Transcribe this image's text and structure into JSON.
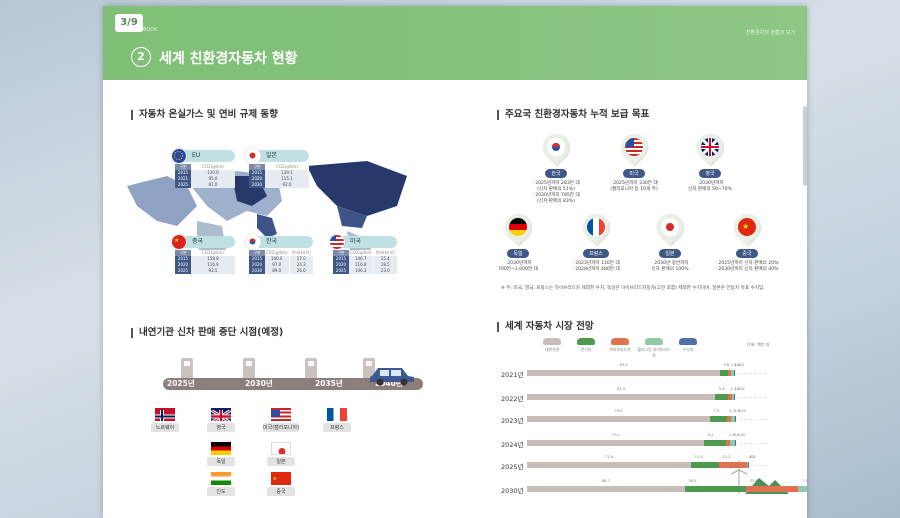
{
  "header": {
    "page_indicator": "3/9",
    "book_label": "BOOK",
    "right_label": "친환경차의 현황과 보기",
    "section_number": "2",
    "section_title": "세계 친환경자동차 현황"
  },
  "emissions": {
    "title": "자동차 온실가스 및 연비 규제 동향",
    "regions": [
      {
        "name": "EU",
        "col1": "구분",
        "col2": "CO2(g/km)",
        "rows": [
          [
            "2015",
            "130.0"
          ],
          [
            "2021",
            "95.0"
          ],
          [
            "2025",
            "81.0"
          ]
        ]
      },
      {
        "name": "일본",
        "col1": "구분",
        "col2": "CO2(g/km)",
        "rows": [
          [
            "2015",
            "139.1"
          ],
          [
            "2020",
            "115.1"
          ],
          [
            "2030",
            "92.0"
          ]
        ]
      },
      {
        "name": "중국",
        "col1": "구분",
        "col2": "CO2(g/km)",
        "rows": [
          [
            "2015",
            "158.8"
          ],
          [
            "2020",
            "116.9"
          ],
          [
            "2025",
            "93.5"
          ]
        ]
      },
      {
        "name": "한국",
        "col1": "구분",
        "col2": "CO2(g/km)",
        "col3": "연비(km/l)",
        "rows": [
          [
            "2015",
            "140.0",
            "17.0"
          ],
          [
            "2020",
            "97.0",
            "24.3"
          ],
          [
            "2030",
            "89.0",
            "26.0"
          ]
        ]
      },
      {
        "name": "미국",
        "col1": "구분",
        "col2": "CO2(g/km)",
        "col3": "연비(km/l)",
        "rows": [
          [
            "2015",
            "146.7",
            "15.4"
          ],
          [
            "2020",
            "116.8",
            "18.5"
          ],
          [
            "2025",
            "106.3",
            "23.0"
          ]
        ]
      }
    ]
  },
  "phaseout": {
    "title": "내연기관 신차 판매 중단 시점(예정)",
    "years": [
      "2025년",
      "2030년",
      "2035년",
      "2040년"
    ],
    "countries": {
      "y2025": [
        "노르웨이"
      ],
      "y2030": [
        "영국",
        "독일",
        "인도"
      ],
      "y2035": [
        "미국(캘리포니아)",
        "일본",
        "중국"
      ],
      "y2040": [
        "프랑스"
      ]
    }
  },
  "targets": {
    "title": "주요국 친환경자동차 누적 보급 목표",
    "items": [
      {
        "name": "한국",
        "desc": [
          "· 2025년까지 283만 대",
          "(신차 판매의 51%)",
          "· 2030년까지 785만 대",
          "(신차 판매의 83%)"
        ]
      },
      {
        "name": "미국",
        "desc": [
          "· 2025년까지 330만 대",
          "(캘리포니아 등 10개 주)"
        ]
      },
      {
        "name": "영국",
        "desc": [
          "· 2030년까지",
          "신차 판매의 50~70%"
        ]
      },
      {
        "name": "독일",
        "desc": [
          "· 2030년까지",
          "700만~1,000만 대"
        ]
      },
      {
        "name": "프랑스",
        "desc": [
          "· 2023년까지 116만 대",
          "· 2028년까지 480만 대"
        ]
      },
      {
        "name": "일본",
        "desc": [
          "· 2030년 중반까지",
          "신차 판매의 100%"
        ]
      },
      {
        "name": "중국",
        "desc": [
          "· 2025년까지 신차 판매의 20%",
          "· 2030년까지 신차 판매의 40%"
        ]
      }
    ],
    "note": "※ 주: 미국, 영국, 프랑스는 하이브리드차 제외한 수치, 독일은 하이브리드자동차(고전 포함) 제외한 수치이며, 일본은 전동차 목표 수치임."
  },
  "market": {
    "title": "세계 자동차 시장 전망",
    "unit": "단위: 백만 대",
    "legend": [
      {
        "label": "내연기관",
        "color": "#c8bdb8"
      },
      {
        "label": "전기차",
        "color": "#4c9a4e"
      },
      {
        "label": "하이브리드차",
        "color": "#e0734f"
      },
      {
        "label": "플러그인 하이브리드차",
        "color": "#8cc9a6"
      },
      {
        "label": "수소차",
        "color": "#4f6fa8"
      }
    ]
  },
  "chart_data": {
    "type": "bar",
    "stacked": true,
    "orientation": "horizontal",
    "title": "세계 자동차 시장 전망",
    "unit": "단위: 백만 대",
    "categories": [
      "2021년",
      "2022년",
      "2023년",
      "2024년",
      "2025년",
      "2030년"
    ],
    "series": [
      {
        "name": "내연기관",
        "color": "#c8bdb8",
        "values": [
          83.9,
          81.9,
          79.5,
          77.0,
          71.4,
          68.7
        ]
      },
      {
        "name": "전기차",
        "color": "#4c9a4e",
        "values": [
          3.6,
          5.4,
          7.3,
          9.4,
          11.9,
          26.5
        ]
      },
      {
        "name": "하이브리드차",
        "color": "#e0734f",
        "values": [
          1.4,
          1.7,
          1.7,
          1.9,
          12.2,
          22.6
        ]
      },
      {
        "name": "플러그인 하이브리드차",
        "color": "#8cc9a6",
        "values": [
          1.2,
          1.2,
          2.0,
          2.0,
          0.2,
          7.0
        ]
      },
      {
        "name": "수소차",
        "color": "#4f6fa8",
        "values": [
          0.01,
          0.02,
          0.03,
          0.05,
          0.1,
          0.6
        ]
      }
    ],
    "value_labels": [
      [
        "83.9",
        "3.6",
        "1.4",
        "1.2",
        "0.01"
      ],
      [
        "81.9",
        "5.4",
        "1.7",
        "1.2",
        "0.02"
      ],
      [
        "79.5",
        "7.3",
        "1.7",
        "2.0",
        "0.03"
      ],
      [
        "77.0",
        "9.4",
        "1.9",
        "2.0",
        "0.05"
      ],
      [
        "71.4",
        "11.9",
        "12.2",
        "0.2",
        "0.1"
      ],
      [
        "68.7",
        "26.5",
        "22.6",
        "7.0",
        "0.6"
      ]
    ]
  }
}
